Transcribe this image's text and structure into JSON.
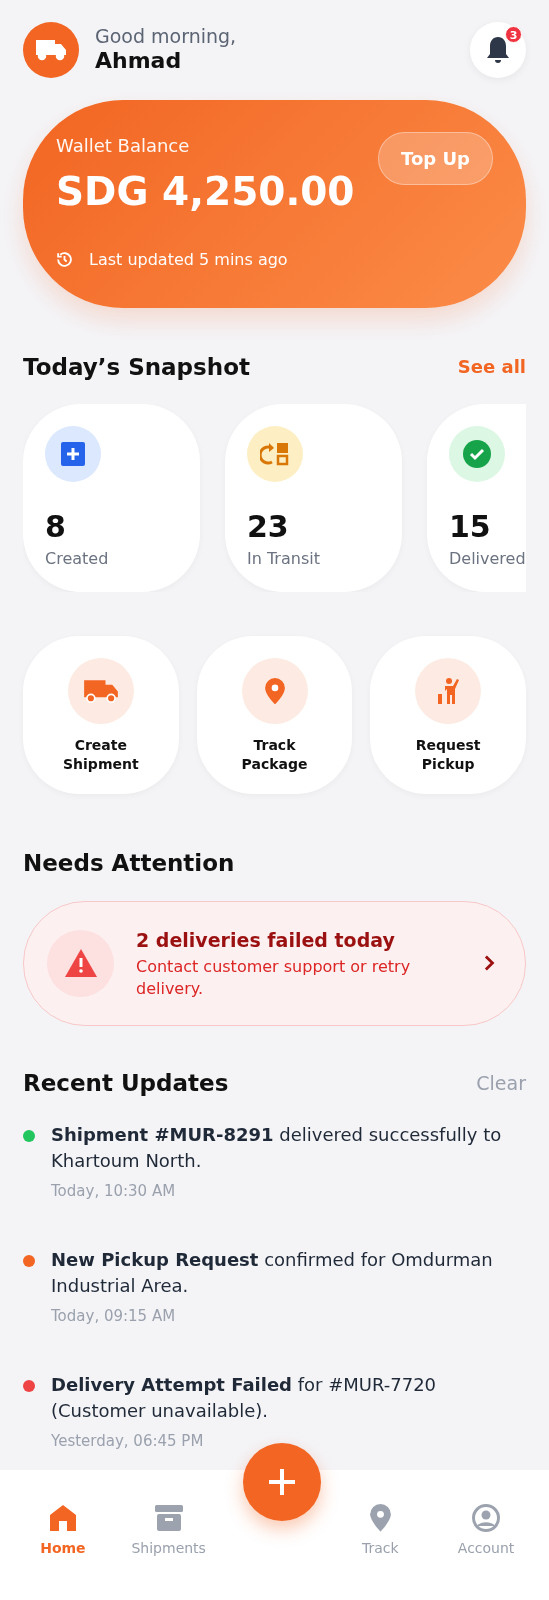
{
  "header": {
    "greeting": "Good morning,",
    "user_name": "Ahmad",
    "notification_count": "3"
  },
  "wallet": {
    "label": "Wallet Balance",
    "balance": "SDG 4,250.00",
    "top_up": "Top Up",
    "updated": "Last updated 5 mins ago"
  },
  "snapshot": {
    "title": "Today’s Snapshot",
    "see_all": "See all",
    "stats": [
      {
        "kind": "created",
        "value": "8",
        "label": "Created"
      },
      {
        "kind": "transit",
        "value": "23",
        "label": "In Transit"
      },
      {
        "kind": "delivered",
        "value": "15",
        "label": "Delivered"
      }
    ]
  },
  "quick_actions": [
    {
      "kind": "truck",
      "label": "Create Shipment"
    },
    {
      "kind": "pin",
      "label": "Track Package"
    },
    {
      "kind": "pickup",
      "label": "Request Pickup"
    }
  ],
  "attention": {
    "title": "Needs Attention",
    "alert_title": "2 deliveries failed today",
    "alert_text": "Contact customer support or retry delivery."
  },
  "recent": {
    "title": "Recent Updates",
    "clear": "Clear",
    "items": [
      {
        "color": "#22c55e",
        "text": "**Shipment #MUR-8291** delivered successfully to Khartoum North.",
        "time": "Today, 10:30 AM"
      },
      {
        "color": "#f26522",
        "text": "**New Pickup Request** confirmed for Omdurman Industrial Area.",
        "time": "Today, 09:15 AM"
      },
      {
        "color": "#ef4444",
        "text": "**Delivery Attempt Failed** for #MUR-7720 (Customer unavailable).",
        "time": "Yesterday, 06:45 PM"
      }
    ]
  },
  "nav": [
    {
      "kind": "home",
      "label": "Home",
      "selected": true
    },
    {
      "kind": "box",
      "label": "Shipments",
      "selected": false
    },
    {
      "kind": "fab"
    },
    {
      "kind": "pin",
      "label": "Track",
      "selected": false
    },
    {
      "kind": "account",
      "label": "Account",
      "selected": false
    }
  ]
}
